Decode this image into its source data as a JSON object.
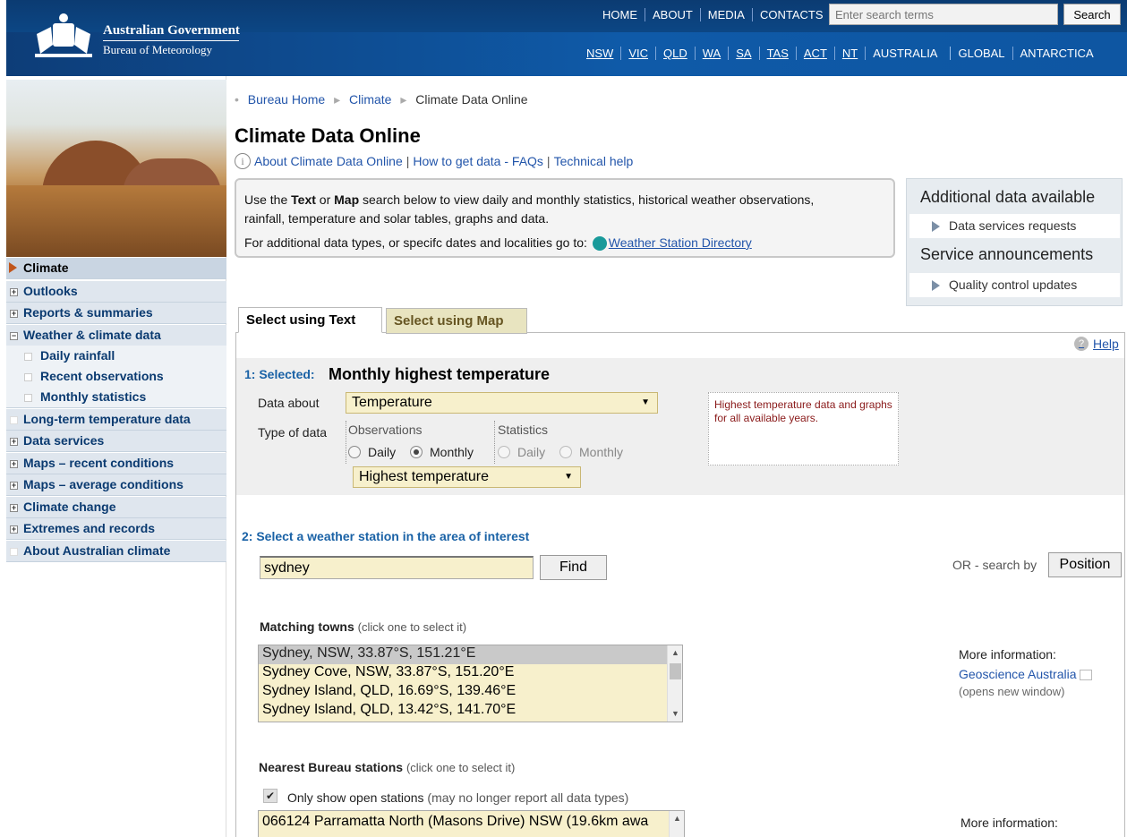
{
  "header": {
    "org_line1": "Australian Government",
    "org_line2": "Bureau of Meteorology",
    "topnav": [
      "HOME",
      "ABOUT",
      "MEDIA",
      "CONTACTS"
    ],
    "search_placeholder": "Enter search terms",
    "search_button": "Search",
    "statenav": [
      "NSW",
      "VIC",
      "QLD",
      "WA",
      "SA",
      "TAS",
      "ACT",
      "NT",
      "AUSTRALIA",
      "GLOBAL",
      "ANTARCTICA"
    ]
  },
  "sidebar": {
    "items": [
      {
        "label": "Climate"
      },
      {
        "label": "Outlooks",
        "marker": "+"
      },
      {
        "label": "Reports & summaries",
        "marker": "+"
      },
      {
        "label": "Weather & climate data",
        "marker": "−"
      },
      {
        "label": "Daily rainfall"
      },
      {
        "label": "Recent observations"
      },
      {
        "label": "Monthly statistics"
      },
      {
        "label": "Long-term temperature data"
      },
      {
        "label": "Data services",
        "marker": "+"
      },
      {
        "label": "Maps – recent conditions",
        "marker": "+"
      },
      {
        "label": "Maps – average conditions",
        "marker": "+"
      },
      {
        "label": "Climate change",
        "marker": "+"
      },
      {
        "label": "Extremes and records",
        "marker": "+"
      },
      {
        "label": "About Australian climate"
      }
    ]
  },
  "breadcrumb": {
    "home": "Bureau Home",
    "climate": "Climate",
    "current": "Climate Data Online"
  },
  "page_title": "Climate Data Online",
  "info_links": {
    "about": "About Climate Data Online",
    "faq": "How to get data - FAQs",
    "help": "Technical help",
    "sep": "|"
  },
  "intro": {
    "l1_a": "Use the ",
    "l1_text": "Text",
    "l1_b": " or ",
    "l1_map": "Map",
    "l1_c": " search below to view daily and monthly statistics, historical weather observations,",
    "l2": "rainfall, temperature and solar tables, graphs and data.",
    "l3": "For additional data types, or specifc dates and localities go to:",
    "wsd": "Weather Station Directory"
  },
  "side_panel": {
    "h1": "Additional data available",
    "r1": "Data services requests",
    "h2": "Service announcements",
    "r2": "Quality control updates"
  },
  "tabs": {
    "text": "Select using Text",
    "map": "Select using Map"
  },
  "help": "Help",
  "step1": {
    "label": "1: Selected:",
    "value": "Monthly highest temperature",
    "data_about_label": "Data about",
    "data_about_value": "Temperature",
    "type_label": "Type of data",
    "obs_header": "Observations",
    "stats_header": "Statistics",
    "daily": "Daily",
    "monthly": "Monthly",
    "sub_value": "Highest temperature",
    "hint": "Highest temperature data and graphs for all available years."
  },
  "step2": {
    "label": "2:  Select a weather station in the area of interest",
    "input_value": "sydney",
    "find": "Find",
    "or_text": "OR - search by",
    "position": "Position"
  },
  "towns": {
    "title": "Matching towns",
    "note": "(click one to select it)",
    "options": [
      "Sydney, NSW, 33.87°S, 151.21°E",
      "Sydney Cove, NSW, 33.87°S, 151.20°E",
      "Sydney Island, QLD, 16.69°S, 139.46°E",
      "Sydney Island, QLD, 13.42°S, 141.70°E"
    ]
  },
  "more_info": {
    "label": "More information:",
    "link": "Geoscience Australia",
    "note": "(opens new window)"
  },
  "stations": {
    "title": "Nearest Bureau stations",
    "note": "(click one to select it)",
    "open_label": "Only show open stations",
    "open_note": "(may no longer report all data types)",
    "first": "066124 Parramatta North (Masons Drive) NSW (19.6km awa",
    "more_info": "More information:"
  }
}
